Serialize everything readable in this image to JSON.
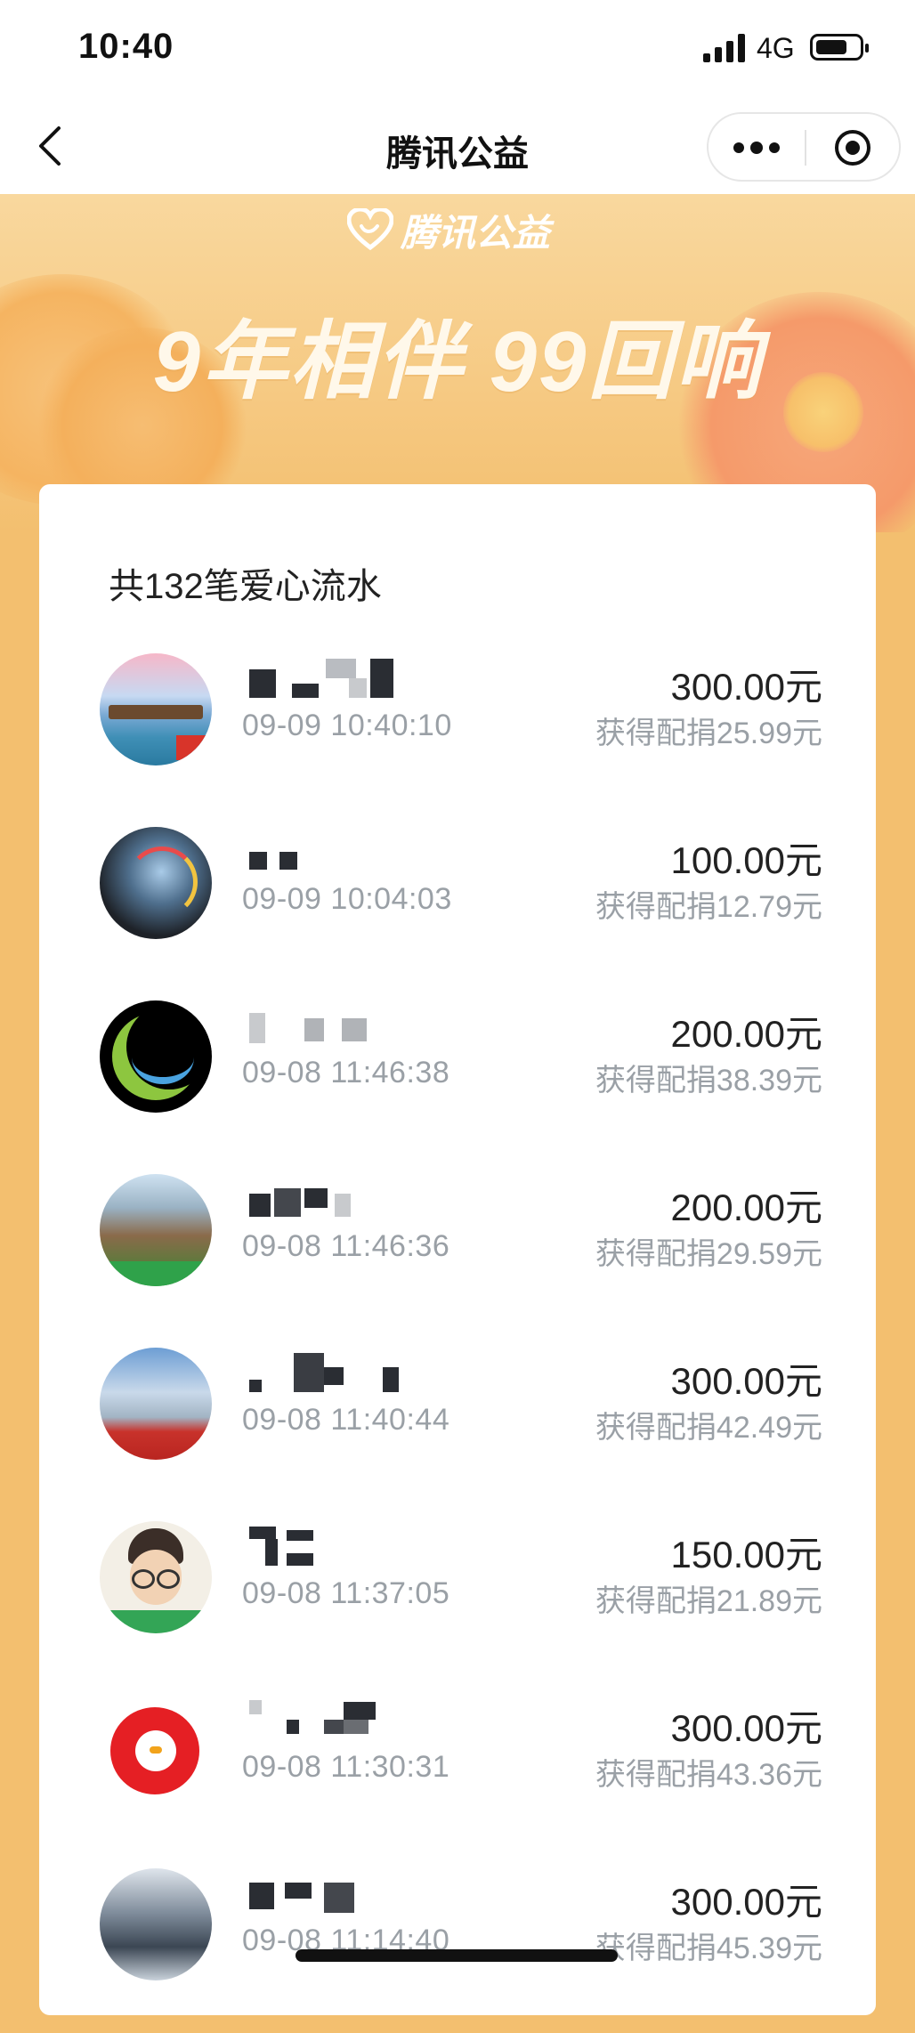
{
  "status_bar": {
    "time": "10:40",
    "network": "4G"
  },
  "nav": {
    "title": "腾讯公益"
  },
  "banner": {
    "brand": "腾讯公益",
    "slogan": "9年相伴 99回响"
  },
  "records": {
    "count_label": "共132笔爱心流水",
    "items": [
      {
        "time": "09-09 10:40:10",
        "amount": "300.00元",
        "match": "获得配捐25.99元"
      },
      {
        "time": "09-09 10:04:03",
        "amount": "100.00元",
        "match": "获得配捐12.79元"
      },
      {
        "time": "09-08 11:46:38",
        "amount": "200.00元",
        "match": "获得配捐38.39元"
      },
      {
        "time": "09-08 11:46:36",
        "amount": "200.00元",
        "match": "获得配捐29.59元"
      },
      {
        "time": "09-08 11:40:44",
        "amount": "300.00元",
        "match": "获得配捐42.49元"
      },
      {
        "time": "09-08 11:37:05",
        "amount": "150.00元",
        "match": "获得配捐21.89元"
      },
      {
        "time": "09-08 11:30:31",
        "amount": "300.00元",
        "match": "获得配捐43.36元"
      },
      {
        "time": "09-08 11:14:40",
        "amount": "300.00元",
        "match": "获得配捐45.39元"
      }
    ]
  },
  "colors": {
    "banner": "#f6c982",
    "page_bg": "#f3bf6f",
    "muted_text": "#9aa0a6"
  },
  "icons": [
    "back-icon",
    "more-icon",
    "target-icon",
    "heart-logo-icon",
    "signal-icon",
    "battery-icon"
  ]
}
